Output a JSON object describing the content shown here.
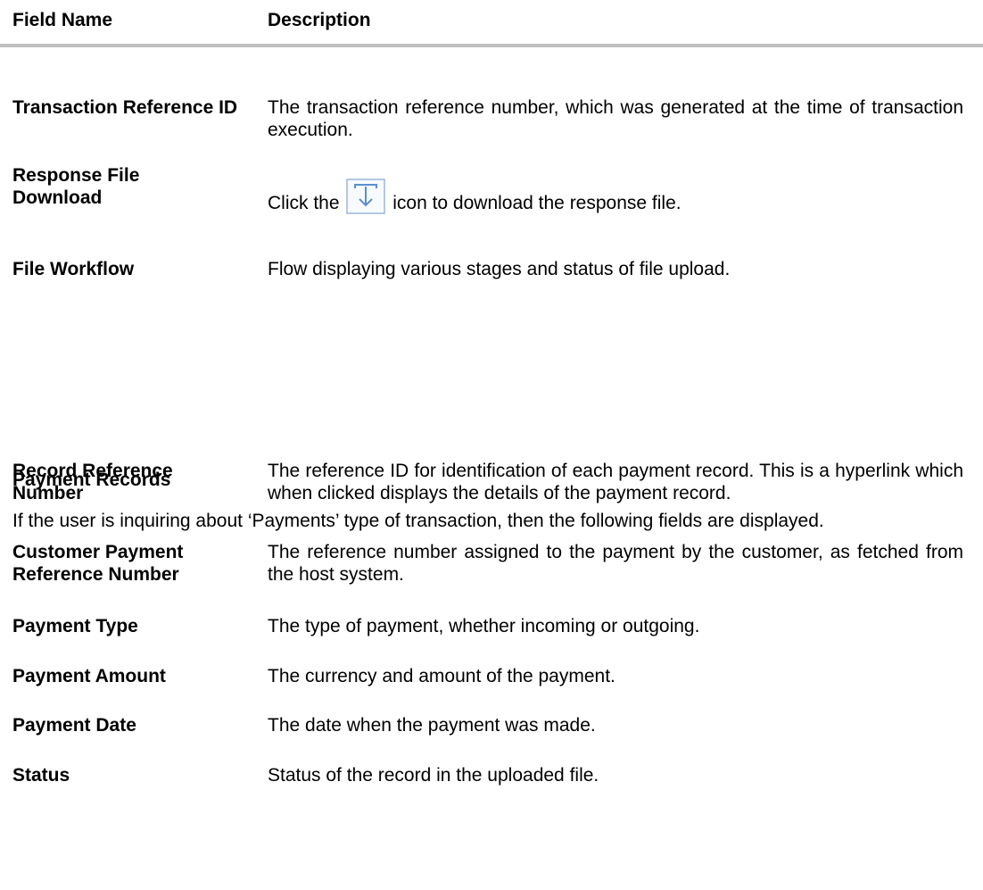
{
  "header": {
    "field_label": "Field Name",
    "description_label": "Description"
  },
  "fields_top": [
    {
      "name": "Transaction Reference ID",
      "description": "The transaction reference number, which was generated at the time of transaction execution."
    },
    {
      "name": "Response File Download",
      "description_before": "Click the",
      "description_after": "icon to download the response file.",
      "icon": "download-icon"
    },
    {
      "name": "File Workflow",
      "description": "Flow displaying various stages and status of file upload."
    }
  ],
  "payment_records": {
    "title": "Payment Records",
    "intro": "If the user is inquiring about ‘Payments’ type of transaction, then the following fields are displayed.",
    "fields": [
      {
        "name": "Record Reference Number",
        "description": "The reference ID for identification of each payment record. This is a hyperlink which when clicked displays the details of the payment record."
      },
      {
        "name": "Customer Payment Reference Number",
        "description": "The reference number assigned to the payment by the customer, as fetched from the host system."
      },
      {
        "name": "Payment Type",
        "description": "The type of payment, whether incoming or outgoing."
      },
      {
        "name": "Payment Amount",
        "description": "The currency and amount of the payment."
      },
      {
        "name": "Payment Date",
        "description": "The date when the payment was made."
      },
      {
        "name": "Status",
        "description": "Status of the record in the uploaded file."
      }
    ]
  },
  "colors": {
    "rule": "#c0c0c0",
    "icon_stroke": "#5b8fd0",
    "icon_border": "#9ab7dc"
  }
}
